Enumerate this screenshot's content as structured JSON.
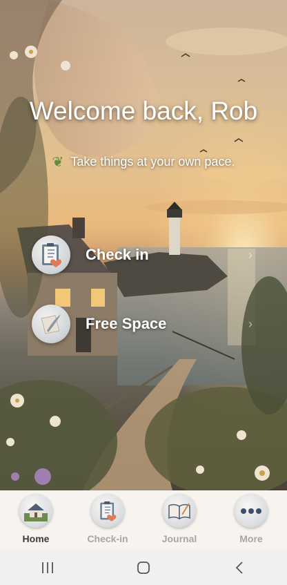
{
  "greeting": "Welcome back, Rob",
  "subtitle": "Take things at your own pace.",
  "actions": [
    {
      "label": "Check in",
      "icon": "clipboard-heart-icon"
    },
    {
      "label": "Free Space",
      "icon": "paper-feather-icon"
    }
  ],
  "tabs": [
    {
      "label": "Home",
      "icon": "cottage-icon",
      "active": true
    },
    {
      "label": "Check-in",
      "icon": "clipboard-heart-icon",
      "active": false
    },
    {
      "label": "Journal",
      "icon": "open-book-icon",
      "active": false
    },
    {
      "label": "More",
      "icon": "more-dots-icon",
      "active": false
    }
  ],
  "system_nav": [
    "recent-apps-icon",
    "home-circle-icon",
    "back-chevron-icon"
  ],
  "colors": {
    "tab_active": "#3a3a3a",
    "tab_inactive": "#a6a6a6",
    "tabbar_bg": "#f7f4f0"
  }
}
